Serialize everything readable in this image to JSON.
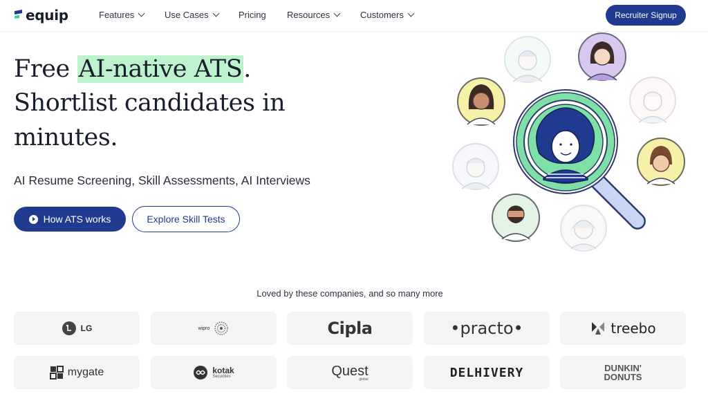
{
  "nav": {
    "logo_text": "equip",
    "items": [
      {
        "label": "Features",
        "has_dropdown": true
      },
      {
        "label": "Use Cases",
        "has_dropdown": true
      },
      {
        "label": "Pricing",
        "has_dropdown": false
      },
      {
        "label": "Resources",
        "has_dropdown": true
      },
      {
        "label": "Customers",
        "has_dropdown": true
      }
    ],
    "signup_label": "Recruiter Signup"
  },
  "hero": {
    "line1_prefix": "Free ",
    "line1_highlight": "AI-native ATS",
    "line1_suffix": ".",
    "line2": "Shortlist candidates in",
    "line3": "minutes.",
    "subtitle": "AI Resume Screening, Skill Assessments, AI Interviews",
    "primary_button": "How ATS works",
    "secondary_button": "Explore Skill Tests"
  },
  "companies": {
    "heading": "Loved by these companies, and so many more",
    "logos": [
      "LG",
      "wipro",
      "Cipla",
      "•practo•",
      "treebo",
      "mygate",
      "kotak",
      "Quest",
      "DELHIVERY",
      "DUNKIN' DONUTS"
    ],
    "kotak_sub": "Securities",
    "quest_sub": "global"
  },
  "colors": {
    "brand": "#1f3a8f",
    "highlight": "#bdf2cd",
    "tile_bg": "#f3f4f6",
    "lens_fill": "#7fe0a7"
  }
}
